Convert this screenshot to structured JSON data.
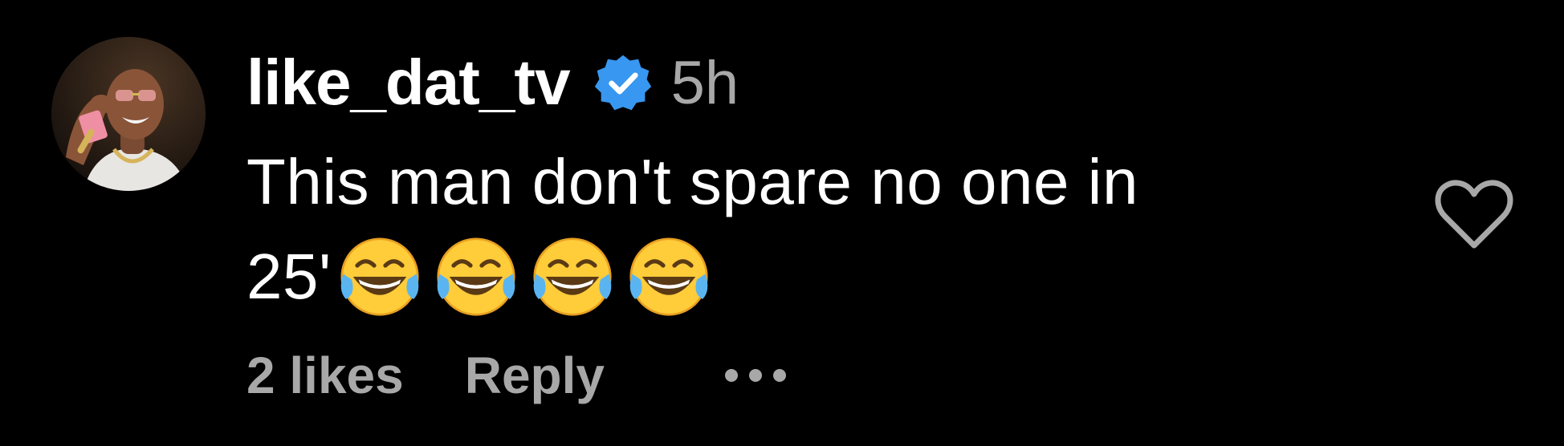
{
  "comment": {
    "username": "like_dat_tv",
    "verified": true,
    "time": "5h",
    "text_line1": "This man don't spare no one in",
    "text_line2_prefix": "25'",
    "emojis": [
      "face-with-tears-of-joy-emoji",
      "face-with-tears-of-joy-emoji",
      "face-with-tears-of-joy-emoji",
      "face-with-tears-of-joy-emoji"
    ],
    "likes": "2 likes",
    "reply_label": "Reply",
    "more_icon": "ellipsis-icon",
    "like_icon": "heart-outline-icon",
    "avatar_icon": "user-avatar"
  },
  "colors": {
    "background": "#000000",
    "text": "#ffffff",
    "secondary": "#a8a8a8",
    "verified_badge": "#3897f0"
  }
}
